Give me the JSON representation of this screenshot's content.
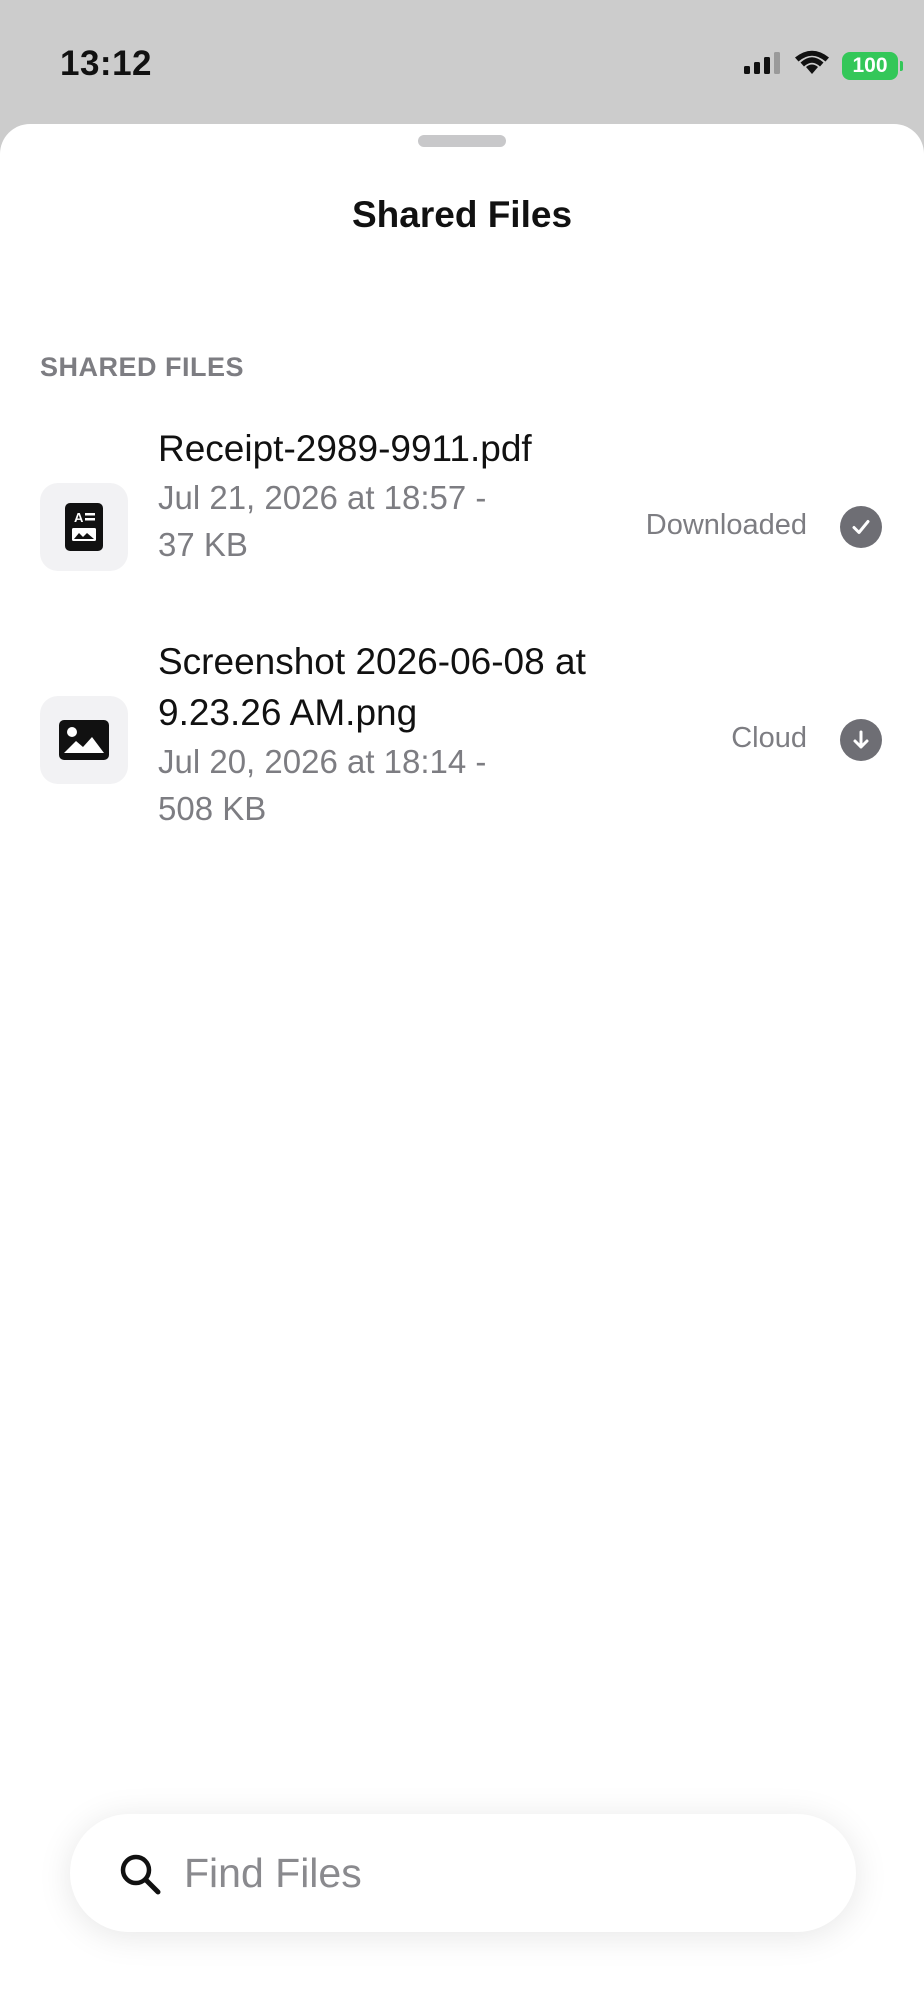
{
  "status_bar": {
    "time": "13:12",
    "battery": "100",
    "icons": [
      "signal-icon",
      "wifi-icon",
      "battery-icon"
    ]
  },
  "sheet": {
    "title": "Shared Files",
    "section_header": "SHARED FILES"
  },
  "files": [
    {
      "name": "Receipt-2989-9911.pdf",
      "meta": "Jul 21, 2026 at 18:57 - 37 KB",
      "status": "Downloaded",
      "icon": "document-icon",
      "status_icon": "checkmark-circle-icon"
    },
    {
      "name": "Screenshot 2026-06-08 at 9.23.26 AM.png",
      "meta": "Jul 20, 2026 at 18:14 - 508 KB",
      "status": "Cloud",
      "icon": "image-icon",
      "status_icon": "download-arrow-circle-icon"
    }
  ],
  "search": {
    "placeholder": "Find Files",
    "value": "",
    "icon": "search-icon"
  },
  "colors": {
    "background": "#cccccc",
    "sheet": "#ffffff",
    "battery_green": "#34c759",
    "secondary_text": "#7d7d82",
    "status_circle": "#6e6e74"
  }
}
